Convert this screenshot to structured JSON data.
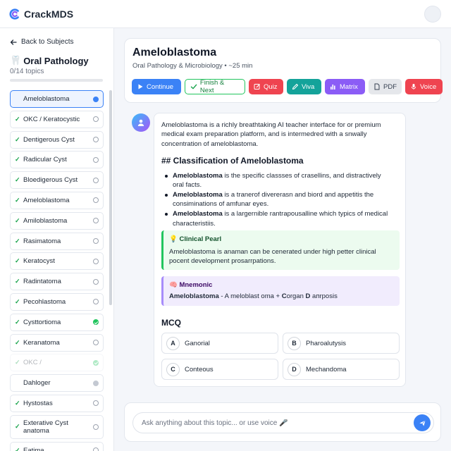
{
  "app": {
    "name": "CrackMDS"
  },
  "sidebar": {
    "back_label": "Back to Subjects",
    "subject_emoji": "🦷",
    "subject_title": "Oral Pathology",
    "progress_text": "0/14 topics",
    "progress_fraction": 0.0,
    "topics": [
      {
        "label": "Ameloblastoma",
        "state": "current",
        "checked": false
      },
      {
        "label": "OKC / Keratocystic",
        "state": "open",
        "checked": true
      },
      {
        "label": "Dentigerous Cyst",
        "state": "open",
        "checked": true
      },
      {
        "label": "Radicular Cyst",
        "state": "open",
        "checked": true
      },
      {
        "label": "Bloedigerous Cyst",
        "state": "open",
        "checked": true
      },
      {
        "label": "Ameloblastoma",
        "state": "open",
        "checked": true
      },
      {
        "label": "Amiloblastoma",
        "state": "open",
        "checked": true
      },
      {
        "label": "Rasimatoma",
        "state": "open",
        "checked": true
      },
      {
        "label": "Keratocyst",
        "state": "open",
        "checked": true
      },
      {
        "label": "Radintatoma",
        "state": "open",
        "checked": true
      },
      {
        "label": "Pecohlastoma",
        "state": "open",
        "checked": true
      },
      {
        "label": "Cysttortioma",
        "state": "done",
        "checked": true
      },
      {
        "label": "Keranatoma",
        "state": "open",
        "checked": true
      },
      {
        "label": "OKC /",
        "state": "faded",
        "checked": true
      },
      {
        "label": "Dahloger",
        "state": "grey",
        "checked": false
      },
      {
        "label": "Hystostas",
        "state": "open",
        "checked": true
      },
      {
        "label": "Exterative Cyst anatoma",
        "state": "open",
        "checked": true
      },
      {
        "label": "Eatima",
        "state": "open",
        "checked": true
      }
    ]
  },
  "header": {
    "title": "Ameloblastoma",
    "subtitle": "Oral Pathology & Microbiology • ~25 min",
    "buttons": {
      "continue": "Continue",
      "finish": "Finish & Next",
      "quiz": "Quiz",
      "viva": "Viva",
      "matrix": "Matrix",
      "pdf": "PDF",
      "voice": "Voice"
    }
  },
  "message": {
    "intro": "Ameloblastoma is a richly breathtaking AI teacher interface for or premium medical exam preparation platform, and is intermedred with a snwally concentration of ameloblastoma.",
    "section_heading": "## Classification of Ameloblastoma",
    "bullets": [
      {
        "term": "Ameloblastoma",
        "text": " is the specific classses of crasellins, and distractively oral facts."
      },
      {
        "term": "Ameloblastoma",
        "text": " is a tranerof divererasn and biord and appetitis the consiminations of amfunar eyes."
      },
      {
        "term": "Ameloblastoma",
        "text": " is a largernible rantrapousalline which typics of medical characteristiis."
      }
    ],
    "pearl_title": "💡 Clinical Pearl",
    "pearl_body": "Ameloblastoma is anaman can be cenerated under high petter clinical pocent development prosarrpations.",
    "mnemonic_title": "🧠 Mnemonic",
    "mnemonic_term": "Ameloblastoma",
    "mnemonic_mid": " - A meloblast oma + ",
    "mnemonic_c": "C",
    "mnemonic_organ": "organ ",
    "mnemonic_d": "D",
    "mnemonic_end": " aпrposis",
    "mcq_heading": "MCQ",
    "options": [
      {
        "letter": "A",
        "text": "Ganorial"
      },
      {
        "letter": "B",
        "text": "Pharoalutysis"
      },
      {
        "letter": "C",
        "text": "Conteous"
      },
      {
        "letter": "D",
        "text": "Mechandoma"
      }
    ]
  },
  "composer": {
    "placeholder": "Ask anything about this topic... or use voice 🎤"
  },
  "colors": {
    "accent": "#3b82f6",
    "success": "#22c55e",
    "danger": "#ef4450",
    "teal": "#14a39a",
    "purple": "#8b5cf6"
  }
}
